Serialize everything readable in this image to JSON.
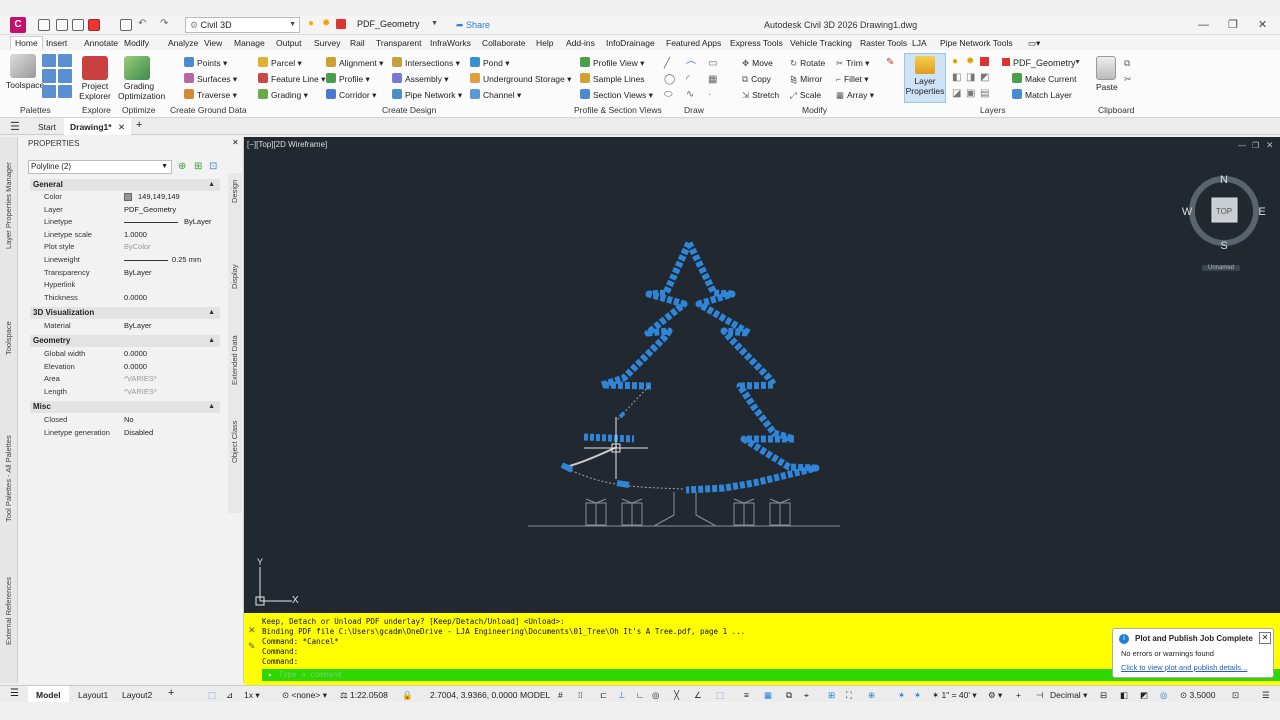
{
  "app": {
    "letter": "C",
    "workspace": "Civil 3D",
    "layer_dropdown": "PDF_Geometry",
    "share": "Share",
    "window_title": "Autodesk Civil 3D 2026   Drawing1.dwg"
  },
  "ribbon_tabs": [
    "Home",
    "Insert",
    "Annotate",
    "Modify",
    "Analyze",
    "View",
    "Manage",
    "Output",
    "Survey",
    "Rail",
    "Transparent",
    "InfraWorks",
    "Collaborate",
    "Help",
    "Add-ins",
    "InfoDrainage",
    "Featured Apps",
    "Express Tools",
    "Vehicle Tracking",
    "Raster Tools",
    "LJA",
    "Pipe Network Tools"
  ],
  "ribbon": {
    "toolspace": "Toolspace",
    "project_explorer": "Project Explorer",
    "grading_optimization": "Grading Optimization",
    "points": "Points",
    "surfaces": "Surfaces",
    "traverse": "Traverse",
    "parcel": "Parcel",
    "feature_line": "Feature Line",
    "grading": "Grading",
    "alignment": "Alignment",
    "profile": "Profile",
    "corridor": "Corridor",
    "intersections": "Intersections",
    "assembly": "Assembly",
    "pipe_network": "Pipe Network",
    "pond": "Pond",
    "underground_storage": "Underground Storage",
    "channel": "Channel",
    "profile_view": "Profile View",
    "sample_lines": "Sample Lines",
    "section_views": "Section Views",
    "move": "Move",
    "rotate": "Rotate",
    "trim": "Trim",
    "copy": "Copy",
    "mirror": "Mirror",
    "fillet": "Fillet",
    "stretch": "Stretch",
    "scale": "Scale",
    "array": "Array",
    "layer_properties": "Layer Properties",
    "layer_name": "PDF_Geometry",
    "make_current": "Make Current",
    "match_layer": "Match Layer",
    "paste": "Paste",
    "panels": [
      "Palettes",
      "Explore",
      "Optimize",
      "Create Ground Data",
      "Create Design",
      "Profile & Section Views",
      "Draw",
      "Modify",
      "Layers",
      "Clipboard"
    ]
  },
  "file_tabs": {
    "start": "Start",
    "drawing": "Drawing1*"
  },
  "palette": {
    "side_tabs": [
      "Layer Properties Manager",
      "Toolspace",
      "Tool Palettes - All Palettes",
      "External References"
    ],
    "header": "PROPERTIES",
    "selection": "Polyline (2)",
    "right_tabs": [
      "Design",
      "Display",
      "Extended Data",
      "Object Class"
    ],
    "general": {
      "title": "General",
      "rows": [
        {
          "k": "Color",
          "v": "149,149,149"
        },
        {
          "k": "Layer",
          "v": "PDF_Geometry"
        },
        {
          "k": "Linetype",
          "v": "ByLayer"
        },
        {
          "k": "Linetype scale",
          "v": "1.0000"
        },
        {
          "k": "Plot style",
          "v": "ByColor"
        },
        {
          "k": "Lineweight",
          "v": "0.25 mm"
        },
        {
          "k": "Transparency",
          "v": "ByLayer"
        },
        {
          "k": "Hyperlink",
          "v": ""
        },
        {
          "k": "Thickness",
          "v": "0.0000"
        }
      ]
    },
    "viz3d": {
      "title": "3D Visualization",
      "rows": [
        {
          "k": "Material",
          "v": "ByLayer"
        }
      ]
    },
    "geometry": {
      "title": "Geometry",
      "rows": [
        {
          "k": "Global width",
          "v": "0.0000"
        },
        {
          "k": "Elevation",
          "v": "0.0000"
        },
        {
          "k": "Area",
          "v": "*VARIES*"
        },
        {
          "k": "Length",
          "v": "*VARIES*"
        }
      ]
    },
    "misc": {
      "title": "Misc",
      "rows": [
        {
          "k": "Closed",
          "v": "No"
        },
        {
          "k": "Linetype generation",
          "v": "Disabled"
        }
      ]
    }
  },
  "viewport": {
    "label": "[−][Top][2D Wireframe]",
    "compass": {
      "n": "N",
      "s": "S",
      "e": "E",
      "w": "W",
      "top": "TOP"
    },
    "wcs": "Unnamed",
    "ucs_y": "Y",
    "ucs_x": "X"
  },
  "command": {
    "lines": [
      "Keep, Detach or Unload PDF underlay? [Keep/Detach/Unload] <Unload>:",
      "Binding PDF file C:\\Users\\gcadm\\OneDrive - LJA Engineering\\Documents\\01_Tree\\Oh It's A Tree.pdf, page 1 ...",
      "Command: *Cancel*",
      "Command:",
      "Command:"
    ],
    "placeholder": "Type a command"
  },
  "notification": {
    "title": "Plot and Publish Job Complete",
    "body": "No errors or warnings found",
    "link": "Click to view plot and publish details..."
  },
  "status": {
    "model_tab": "Model",
    "layout1": "Layout1",
    "layout2": "Layout2",
    "zoom": "1x",
    "filter": "<none>",
    "scale": "1:22.0508",
    "coords": "2.7004, 3.9366, 0.0000",
    "model": "MODEL",
    "annoscale": "1\" = 40'",
    "units": "Decimal",
    "elevation": "3.5000"
  },
  "colors": {
    "viewport_bg": "#212830",
    "tree_blue": "#2f86d9",
    "command_bg": "#ffff00",
    "command_input": "#2fd600",
    "accent_pink": "#c40f6c"
  }
}
